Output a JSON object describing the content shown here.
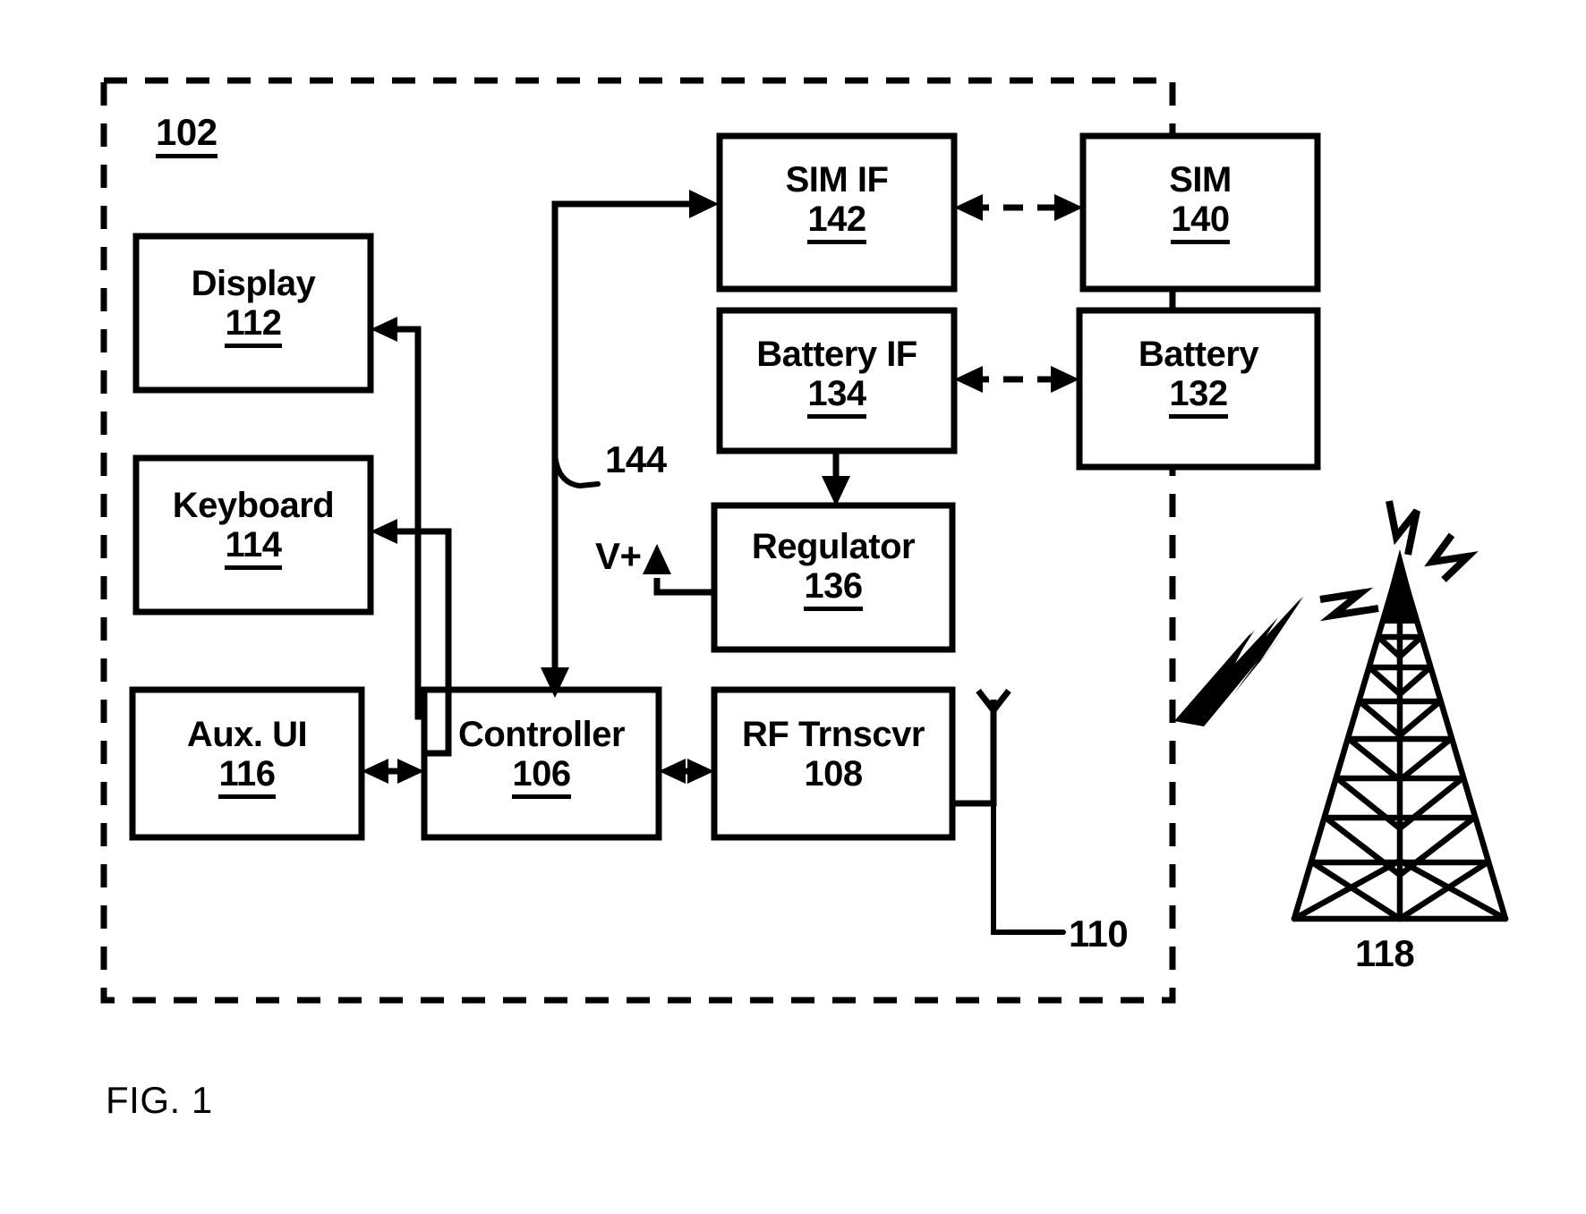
{
  "figure": {
    "caption": "FIG. 1",
    "enclosure_ref": "102",
    "enclosure_name": "mobile-device-boundary"
  },
  "blocks": [
    {
      "id": "display",
      "title": "Display",
      "ref": "112",
      "ref_underlined": true
    },
    {
      "id": "keyboard",
      "title": "Keyboard",
      "ref": "114",
      "ref_underlined": true
    },
    {
      "id": "aux_ui",
      "title": "Aux. UI",
      "ref": "116",
      "ref_underlined": true
    },
    {
      "id": "controller",
      "title": "Controller",
      "ref": "106",
      "ref_underlined": true
    },
    {
      "id": "rf",
      "title": "RF Trnscvr",
      "ref": "108",
      "ref_underlined": false
    },
    {
      "id": "sim_if",
      "title": "SIM IF",
      "ref": "142",
      "ref_underlined": true
    },
    {
      "id": "battery_if",
      "title": "Battery IF",
      "ref": "134",
      "ref_underlined": true
    },
    {
      "id": "regulator",
      "title": "Regulator",
      "ref": "136",
      "ref_underlined": true
    },
    {
      "id": "sim",
      "title": "SIM",
      "ref": "140",
      "ref_underlined": true
    },
    {
      "id": "battery",
      "title": "Battery",
      "ref": "132",
      "ref_underlined": true
    }
  ],
  "annotations": {
    "bus_144": "144",
    "antenna_110": "110",
    "tower_118": "118",
    "supply_rail": "V+"
  },
  "colors": {
    "ink": "#000000",
    "paper": "#ffffff"
  }
}
